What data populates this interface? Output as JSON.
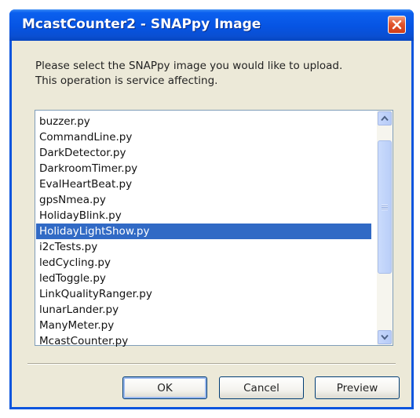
{
  "window": {
    "title": "McastCounter2 - SNAPpy Image",
    "close_icon": "close-icon"
  },
  "prompt": {
    "line1": "Please select the SNAPpy image you would like to upload.",
    "line2": "This operation is service affecting."
  },
  "list": {
    "items": [
      "buzzer.py",
      "CommandLine.py",
      "DarkDetector.py",
      "DarkroomTimer.py",
      "EvalHeartBeat.py",
      "gpsNmea.py",
      "HolidayBlink.py",
      "HolidayLightShow.py",
      "i2cTests.py",
      "ledCycling.py",
      "ledToggle.py",
      "LinkQualityRanger.py",
      "lunarLander.py",
      "ManyMeter.py",
      "McastCounter.py"
    ],
    "selected": "HolidayLightShow.py"
  },
  "buttons": {
    "ok": "OK",
    "cancel": "Cancel",
    "preview": "Preview"
  },
  "colors": {
    "titlebar": "#0a55de",
    "selection": "#316ac5",
    "dialog_bg": "#ece9d8",
    "close_button": "#e2552d"
  }
}
